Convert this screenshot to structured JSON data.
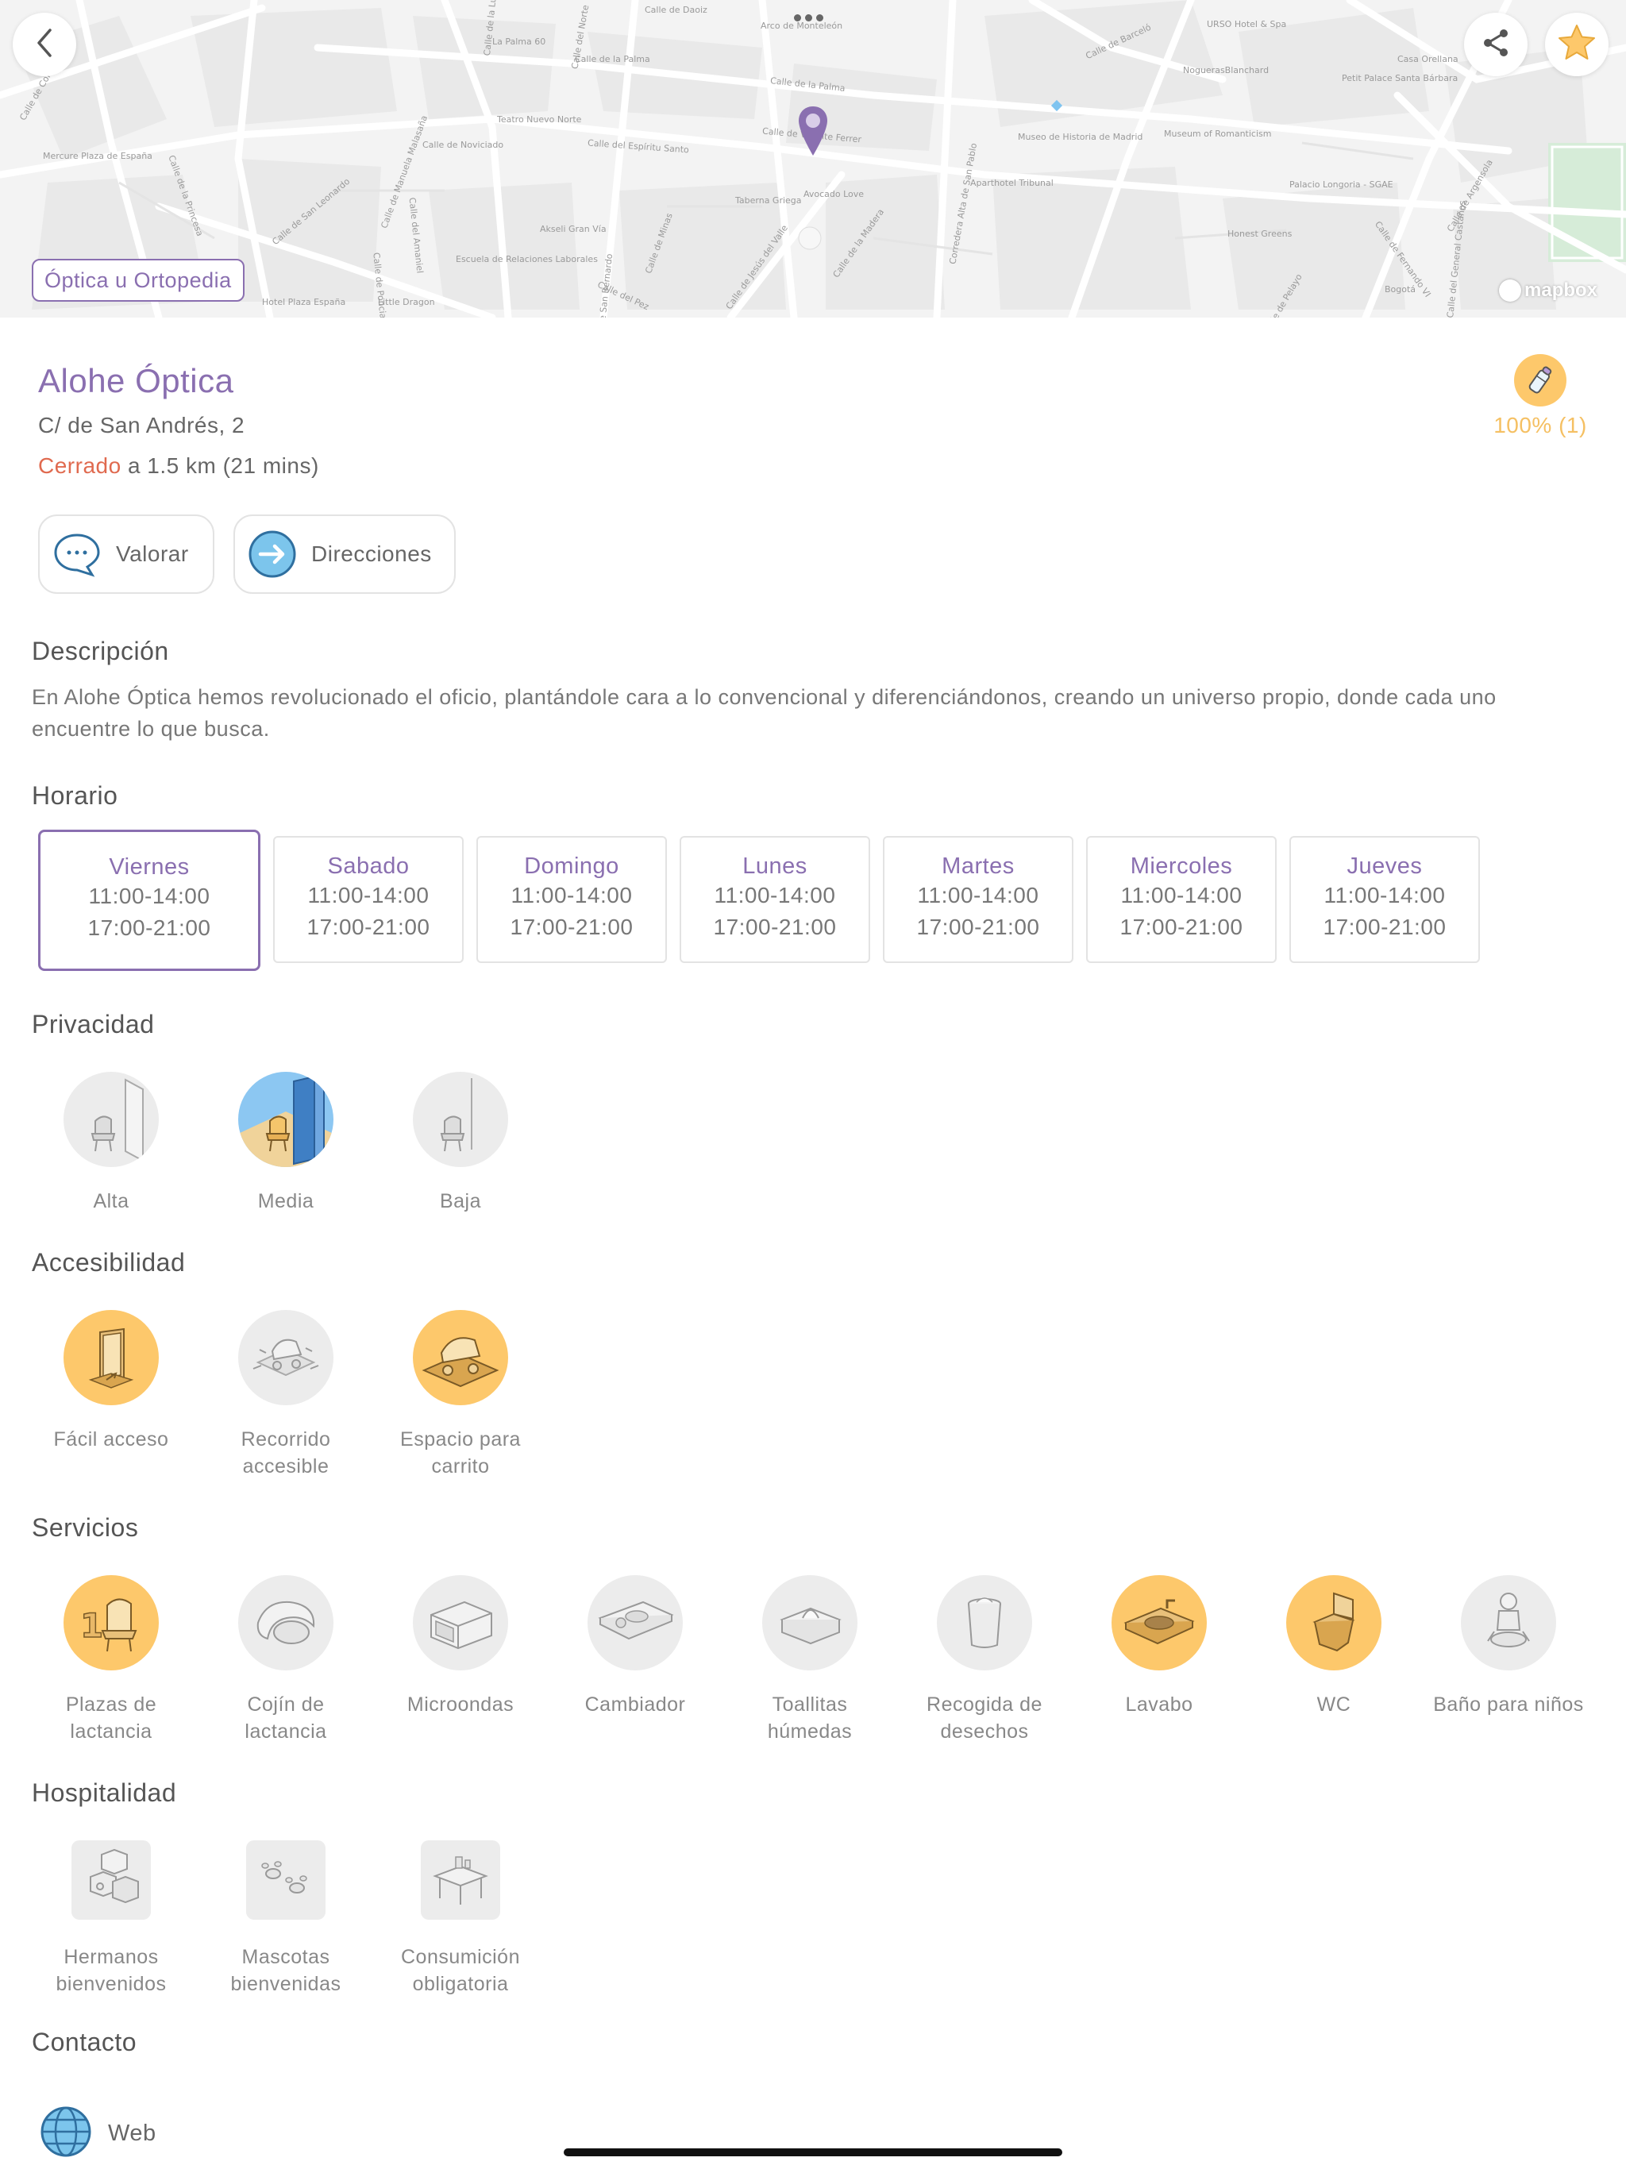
{
  "map": {
    "category_tag": "Óptica u Ortopedia",
    "attribution": "mapbox",
    "street_labels": [
      "Calle de Daoiz",
      "Arco de Monteleón",
      "Calle de la Palma",
      "La Palma 60",
      "Calle de la Palma",
      "Calle de Barceló",
      "URSO Hotel & Spa",
      "Casa Orellana",
      "NoguerasBlanchard",
      "Petit Palace Santa Bárbara",
      "Teatro Nuevo Norte",
      "Calle de Noviciado",
      "Calle del Espíritu Santo",
      "Calle de Vicente Ferrer",
      "Museo de Historia de Madrid",
      "Museum of Romanticism",
      "Mercure Plaza de España",
      "Calle de la Princesa",
      "Calle de San Leonardo",
      "Calle del Amaniel",
      "Calle de Manuela Malasaña",
      "Taberna Griega",
      "Avocado Love",
      "Aparthotel Tribunal",
      "Palacio Longoria - SGAE",
      "Honest Greens",
      "Akseli Gran Vía",
      "Escuela de Relaciones Laborales",
      "Calle de Minas",
      "Calle del Pez",
      "Calle de Jesús del Valle",
      "Calle de la Madera",
      "Corredera Alta de San Pablo",
      "Calle de Fernando VI",
      "Calle de Argensola",
      "Calle del General Castaños",
      "Bogotá",
      "Calle de Pelayo",
      "Little Dragon",
      "Hotel Plaza España",
      "Calle de Ponciano",
      "Calle de San Bernardo",
      "Calle del Norte",
      "Calle de la Luna",
      "Calle de Colón"
    ]
  },
  "place": {
    "name": "Alohe Óptica",
    "address": "C/ de San Andrés, 2",
    "status": "Cerrado",
    "distance": "a 1.5 km (21 mins)",
    "rating": "100% (1)"
  },
  "actions": {
    "rate": "Valorar",
    "directions": "Direcciones"
  },
  "description": {
    "title": "Descripción",
    "text": "En Alohe Óptica hemos revolucionado el oficio, plantándole cara a lo convencional y diferenciándonos, creando un universo propio, donde cada uno encuentre lo que busca."
  },
  "schedule": {
    "title": "Horario",
    "days": [
      {
        "day": "Viernes",
        "morning": "11:00-14:00",
        "evening": "17:00-21:00",
        "selected": true
      },
      {
        "day": "Sabado",
        "morning": "11:00-14:00",
        "evening": "17:00-21:00"
      },
      {
        "day": "Domingo",
        "morning": "11:00-14:00",
        "evening": "17:00-21:00"
      },
      {
        "day": "Lunes",
        "morning": "11:00-14:00",
        "evening": "17:00-21:00"
      },
      {
        "day": "Martes",
        "morning": "11:00-14:00",
        "evening": "17:00-21:00"
      },
      {
        "day": "Miercoles",
        "morning": "11:00-14:00",
        "evening": "17:00-21:00"
      },
      {
        "day": "Jueves",
        "morning": "11:00-14:00",
        "evening": "17:00-21:00"
      }
    ]
  },
  "privacy": {
    "title": "Privacidad",
    "items": [
      {
        "label": "Alta",
        "icon": "privacy-high-icon",
        "active": false
      },
      {
        "label": "Media",
        "icon": "privacy-medium-icon",
        "active": true
      },
      {
        "label": "Baja",
        "icon": "privacy-low-icon",
        "active": false
      }
    ]
  },
  "accessibility": {
    "title": "Accesibilidad",
    "items": [
      {
        "label_1": "Fácil acceso",
        "label_2": "",
        "icon": "door-icon",
        "active": true
      },
      {
        "label_1": "Recorrido",
        "label_2": "accesible",
        "icon": "stroller-route-icon",
        "active": false
      },
      {
        "label_1": "Espacio para",
        "label_2": "carrito",
        "icon": "stroller-space-icon",
        "active": true
      }
    ]
  },
  "services": {
    "title": "Servicios",
    "items": [
      {
        "label_1": "Plazas de",
        "label_2": "lactancia",
        "icon": "nursing-chair-icon",
        "active": true
      },
      {
        "label_1": "Cojín de",
        "label_2": "lactancia",
        "icon": "nursing-pillow-icon",
        "active": false
      },
      {
        "label_1": "Microondas",
        "label_2": "",
        "icon": "microwave-icon",
        "active": false
      },
      {
        "label_1": "Cambiador",
        "label_2": "",
        "icon": "changing-table-icon",
        "active": false
      },
      {
        "label_1": "Toallitas",
        "label_2": "húmedas",
        "icon": "wipes-icon",
        "active": false
      },
      {
        "label_1": "Recogida de",
        "label_2": "desechos",
        "icon": "waste-bin-icon",
        "active": false
      },
      {
        "label_1": "Lavabo",
        "label_2": "",
        "icon": "sink-icon",
        "active": true
      },
      {
        "label_1": "WC",
        "label_2": "",
        "icon": "toilet-icon",
        "active": true
      },
      {
        "label_1": "Baño para niños",
        "label_2": "",
        "icon": "kids-potty-icon",
        "active": false
      }
    ]
  },
  "hospitality": {
    "title": "Hospitalidad",
    "items": [
      {
        "label_1": "Hermanos",
        "label_2": "bienvenidos",
        "icon": "toy-blocks-icon"
      },
      {
        "label_1": "Mascotas",
        "label_2": "bienvenidas",
        "icon": "paw-prints-icon"
      },
      {
        "label_1": "Consumición",
        "label_2": "obligatoria",
        "icon": "table-icon"
      }
    ]
  },
  "contact": {
    "title": "Contacto",
    "web": "Web"
  },
  "colors": {
    "accent": "#8a6fb0",
    "active": "#fdc86b",
    "inactive": "#ececec",
    "closed": "#e06a4f",
    "rating": "#f5c063"
  }
}
